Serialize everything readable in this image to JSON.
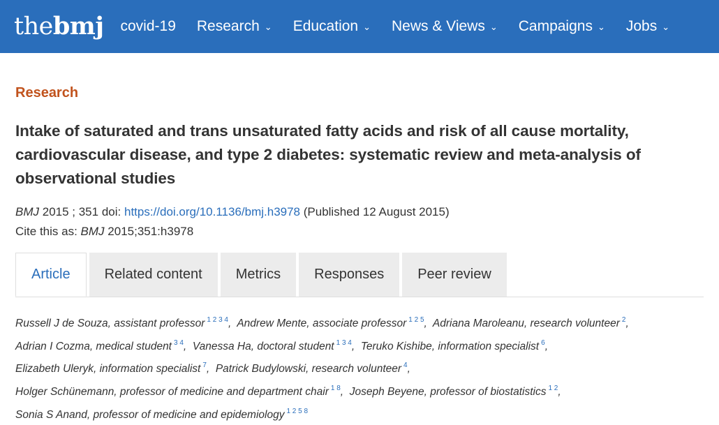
{
  "header": {
    "logo_the": "the",
    "logo_bmj": "bmj",
    "nav": [
      {
        "label": "covid-19",
        "has_chevron": false
      },
      {
        "label": "Research",
        "has_chevron": true
      },
      {
        "label": "Education",
        "has_chevron": true
      },
      {
        "label": "News & Views",
        "has_chevron": true
      },
      {
        "label": "Campaigns",
        "has_chevron": true
      },
      {
        "label": "Jobs",
        "has_chevron": true
      }
    ],
    "chevron": "⌄"
  },
  "article": {
    "section": "Research",
    "title": "Intake of saturated and trans unsaturated fatty acids and risk of all cause mortality, cardiovascular disease, and type 2 diabetes: systematic review and meta-analysis of observational studies",
    "journal": "BMJ",
    "year_vol": "2015 ; 351",
    "doi_label": "doi:",
    "doi": "https://doi.org/10.1136/bmj.h3978",
    "published": "(Published 12 August 2015)",
    "cite_label": "Cite this as:",
    "cite_journal": "BMJ",
    "cite_ref": "2015;351:h3978"
  },
  "tabs": [
    {
      "label": "Article",
      "active": true
    },
    {
      "label": "Related content",
      "active": false
    },
    {
      "label": "Metrics",
      "active": false
    },
    {
      "label": "Responses",
      "active": false
    },
    {
      "label": "Peer review",
      "active": false
    }
  ],
  "authors": {
    "separator": ",",
    "lines": [
      [
        {
          "name": "Russell J de Souza, assistant professor",
          "aff": "1 2 3 4"
        },
        {
          "name": "Andrew Mente, associate professor",
          "aff": "1 2 5"
        },
        {
          "name": "Adriana Maroleanu, research volunteer",
          "aff": "2"
        }
      ],
      [
        {
          "name": "Adrian I Cozma, medical student",
          "aff": "3 4"
        },
        {
          "name": "Vanessa Ha, doctoral student",
          "aff": "1 3 4"
        },
        {
          "name": "Teruko Kishibe, information specialist",
          "aff": "6"
        }
      ],
      [
        {
          "name": "Elizabeth Uleryk, information specialist",
          "aff": "7"
        },
        {
          "name": "Patrick Budylowski, research volunteer",
          "aff": "4"
        }
      ],
      [
        {
          "name": "Holger Schünemann, professor of medicine and department chair",
          "aff": "1 8"
        },
        {
          "name": "Joseph Beyene, professor of biostatistics",
          "aff": "1 2"
        }
      ],
      [
        {
          "name": "Sonia S Anand, professor of medicine and epidemiology",
          "aff": "1 2 5 8"
        }
      ]
    ]
  },
  "colors": {
    "header_bg": "#2a6ebb",
    "section_label": "#c1531d",
    "link": "#2a6ebb"
  }
}
